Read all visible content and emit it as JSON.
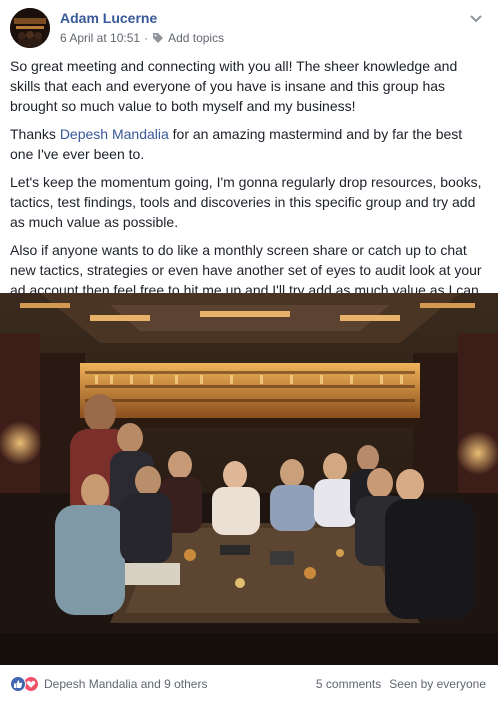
{
  "header": {
    "author": "Adam Lucerne",
    "date": "6 April at 10:51",
    "separator": "·",
    "add_topics": "Add topics"
  },
  "post": {
    "p1": "So great meeting and connecting with you all! The sheer knowledge and skills that each and everyone of you have is insane and this group has brought so much value to both myself and my business!",
    "p2_before": "Thanks ",
    "p2_mention": "Depesh Mandalia",
    "p2_after": " for an amazing mastermind and by far the best one I've ever been to.",
    "p3": "Let's keep the momentum going, I'm gonna regularly drop resources, books, tactics, test findings, tools and discoveries in this specific group and try add as much value as possible.",
    "p4": "Also if anyone wants to do like a monthly screen share or catch up to chat new tactics, strategies or even have another set of eyes to audit look at your ad account then feel free to hit me up and I'll try add as much value as I can."
  },
  "footer": {
    "reactors": "Depesh Mandalia and 9 others",
    "comments": "5 comments",
    "seen": "Seen by everyone"
  },
  "icons": {
    "reactions": [
      "like-icon",
      "love-icon"
    ],
    "chevron": "chevron-down-icon",
    "tag": "tag-icon"
  },
  "colors": {
    "link": "#385898",
    "meta": "#616770",
    "like": "#4267b2",
    "love": "#f25268"
  }
}
